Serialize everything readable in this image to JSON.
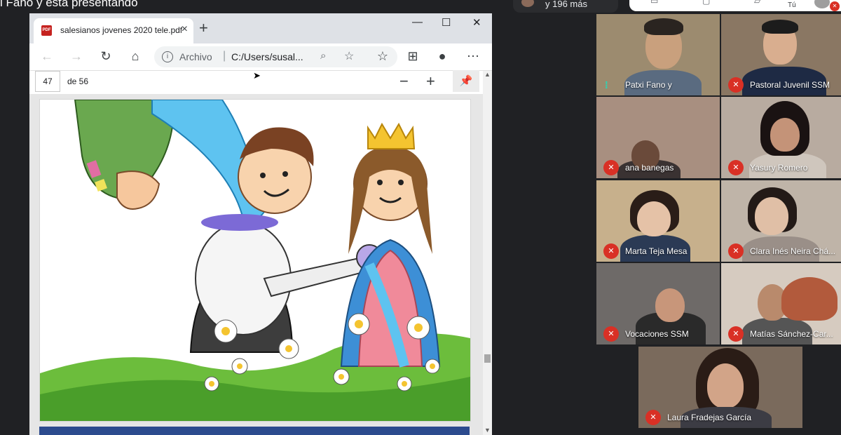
{
  "banner": {
    "text": "i Fano y está presentando"
  },
  "others": {
    "label": "y 196 más"
  },
  "meet": {
    "you_label": "Tú"
  },
  "browser": {
    "tab_title": "salesianos jovenes 2020 tele.pdf",
    "address_protocol": "Archivo",
    "address_url": "C:/Users/susal...",
    "pdf": {
      "current_page": "47",
      "page_total": "de 56"
    }
  },
  "participants": [
    {
      "name": "Patxi Fano y",
      "mic": "speaking"
    },
    {
      "name": "Pastoral Juvenil SSM",
      "mic": "muted"
    },
    {
      "name": "ana banegas",
      "mic": "muted"
    },
    {
      "name": "Yasury Romero",
      "mic": "muted"
    },
    {
      "name": "Marta Teja Mesa",
      "mic": "muted"
    },
    {
      "name": "Clara Inés Neira Chá...",
      "mic": "muted"
    },
    {
      "name": "Vocaciones SSM",
      "mic": "muted"
    },
    {
      "name": "Matías Sánchez-Car...",
      "mic": "muted"
    },
    {
      "name": "Laura Fradejas García",
      "mic": "muted"
    }
  ],
  "colors": {
    "meet_bg": "#202124",
    "muted_red": "#d93025",
    "speaking": "#1ae0c0"
  }
}
